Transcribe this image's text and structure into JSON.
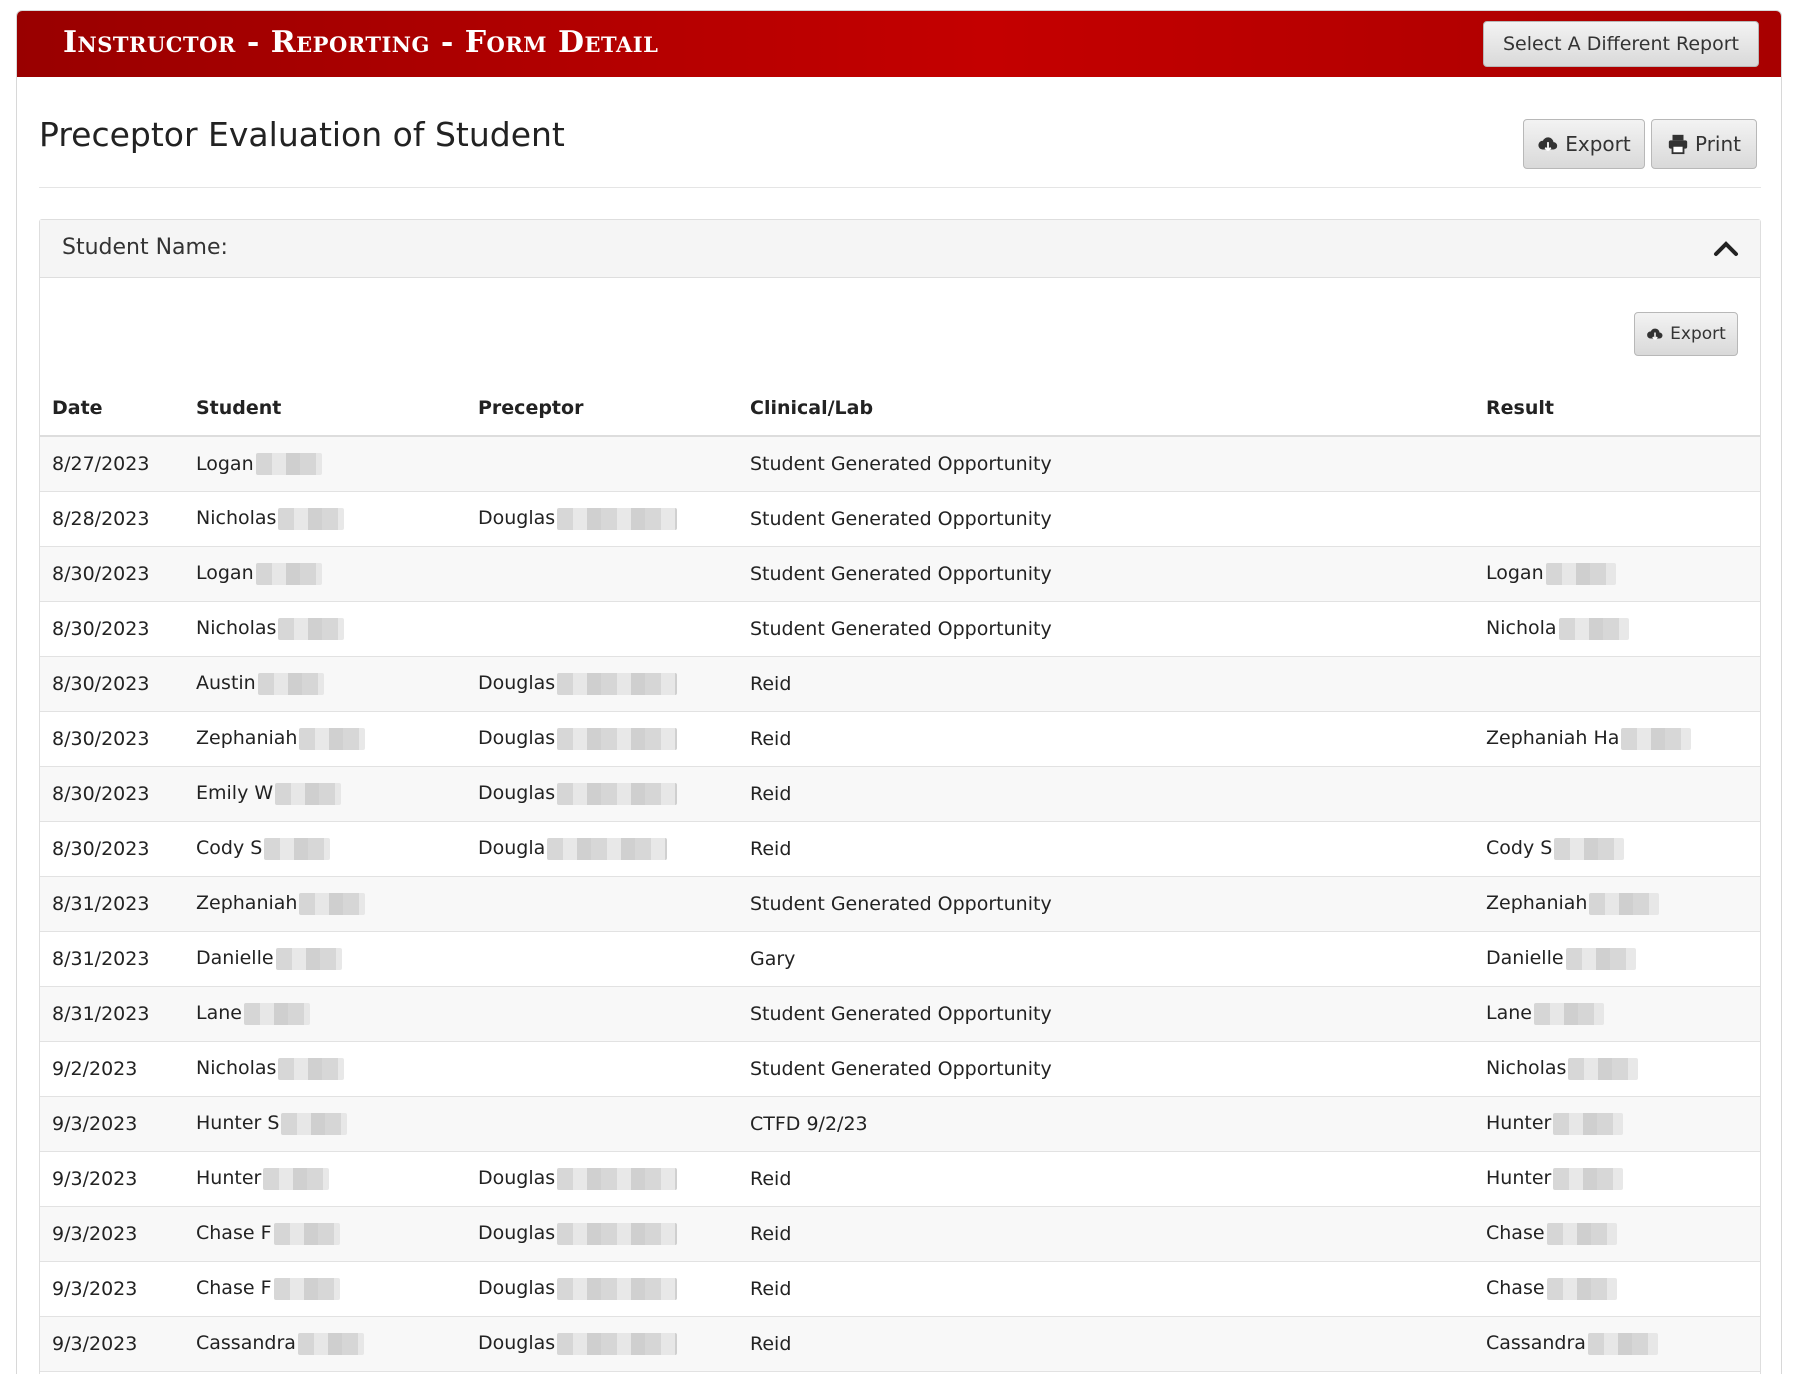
{
  "header": {
    "title": "Instructor - Reporting - Form Detail",
    "select_button": "Select A Different Report"
  },
  "page": {
    "title": "Preceptor Evaluation of Student",
    "export_label": "Export",
    "print_label": "Print"
  },
  "panel": {
    "heading": "Student Name:",
    "export_label": "Export"
  },
  "table": {
    "columns": [
      "Date",
      "Student",
      "Preceptor",
      "Clinical/Lab",
      "Result"
    ],
    "rows": [
      {
        "date": "8/27/2023",
        "student": "Logan",
        "preceptor": "",
        "clinical": "Student Generated Opportunity",
        "result": ""
      },
      {
        "date": "8/28/2023",
        "student": "Nicholas",
        "preceptor": "Douglas",
        "clinical": "Student Generated Opportunity",
        "result": ""
      },
      {
        "date": "8/30/2023",
        "student": "Logan",
        "preceptor": "",
        "clinical": "Student Generated Opportunity",
        "result": "Logan"
      },
      {
        "date": "8/30/2023",
        "student": "Nicholas",
        "preceptor": "",
        "clinical": "Student Generated Opportunity",
        "result": "Nichola"
      },
      {
        "date": "8/30/2023",
        "student": "Austin",
        "preceptor": "Douglas",
        "clinical": "Reid",
        "result": ""
      },
      {
        "date": "8/30/2023",
        "student": "Zephaniah",
        "preceptor": "Douglas",
        "clinical": "Reid",
        "result": "Zephaniah Ha"
      },
      {
        "date": "8/30/2023",
        "student": "Emily W",
        "preceptor": "Douglas",
        "clinical": "Reid",
        "result": ""
      },
      {
        "date": "8/30/2023",
        "student": "Cody S",
        "preceptor": "Dougla",
        "clinical": "Reid",
        "result": "Cody S"
      },
      {
        "date": "8/31/2023",
        "student": "Zephaniah",
        "preceptor": "",
        "clinical": "Student Generated Opportunity",
        "result": "Zephaniah"
      },
      {
        "date": "8/31/2023",
        "student": "Danielle",
        "preceptor": "",
        "clinical": "Gary",
        "result": "Danielle"
      },
      {
        "date": "8/31/2023",
        "student": "Lane",
        "preceptor": "",
        "clinical": "Student Generated Opportunity",
        "result": "Lane"
      },
      {
        "date": "9/2/2023",
        "student": "Nicholas",
        "preceptor": "",
        "clinical": "Student Generated Opportunity",
        "result": "Nicholas"
      },
      {
        "date": "9/3/2023",
        "student": "Hunter S",
        "preceptor": "",
        "clinical": "CTFD 9/2/23",
        "result": "Hunter"
      },
      {
        "date": "9/3/2023",
        "student": "Hunter",
        "preceptor": "Douglas",
        "clinical": "Reid",
        "result": "Hunter"
      },
      {
        "date": "9/3/2023",
        "student": "Chase F",
        "preceptor": "Douglas",
        "clinical": "Reid",
        "result": "Chase"
      },
      {
        "date": "9/3/2023",
        "student": "Chase F",
        "preceptor": "Douglas",
        "clinical": "Reid",
        "result": "Chase"
      },
      {
        "date": "9/3/2023",
        "student": "Cassandra",
        "preceptor": "Douglas",
        "clinical": "Reid",
        "result": "Cassandra"
      }
    ]
  },
  "icons": {
    "export": "cloud-download-icon",
    "print": "printer-icon",
    "collapse": "chevron-up-icon"
  },
  "colors": {
    "header_red": "#b00000",
    "header_text": "#ffffff"
  }
}
